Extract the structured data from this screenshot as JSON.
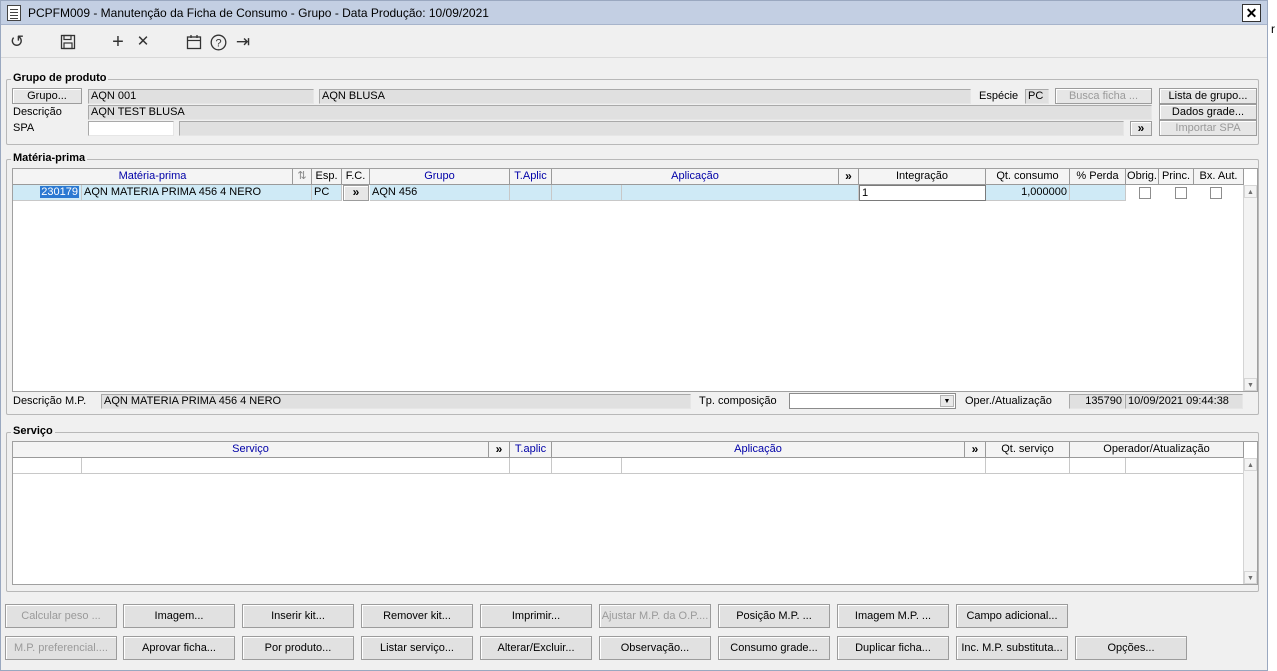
{
  "window": {
    "title": "PCPFM009 - Manutenção da Ficha de Consumo - Grupo - Data Produção: 10/09/2021",
    "close": "✕"
  },
  "toolbar": {
    "refresh": "↺",
    "save": "💾",
    "add": "+",
    "delete": "✕",
    "calendar": "📅",
    "help": "?",
    "exit": "⇥"
  },
  "grupo_produto": {
    "title": "Grupo de produto",
    "grupo_button": "Grupo...",
    "grupo_code": "AQN 001",
    "grupo_name": "AQN BLUSA",
    "especie_label": "Espécie",
    "especie_value": "PC",
    "busca_ficha": "Busca ficha ...",
    "lista_grupo": "Lista de grupo...",
    "descricao_label": "Descrição",
    "descricao_value": "AQN TEST BLUSA",
    "dados_grade": "Dados grade...",
    "spa_label": "SPA",
    "spa_value": "",
    "spa_more": "»",
    "importar_spa": "Importar SPA"
  },
  "materia_prima": {
    "title": "Matéria-prima",
    "headers": {
      "materia": "Matéria-prima",
      "sort": "⇅",
      "esp": "Esp.",
      "fc": "F.C.",
      "grupo": "Grupo",
      "taplic": "T.Aplic",
      "aplicacao": "Aplicação",
      "more": "»",
      "integracao": "Integração",
      "qt_consumo": "Qt. consumo",
      "perda": "% Perda",
      "obrig": "Obrig.",
      "princ": "Princ.",
      "bxaut": "Bx. Aut."
    },
    "row": {
      "code": "230179",
      "name": "AQN MATERIA PRIMA 456 4 NERO",
      "esp": "PC",
      "fc": "»",
      "grupo": "AQN 456",
      "integracao": "1",
      "qt_consumo": "1,000000"
    },
    "descricao_label": "Descrição M.P.",
    "descricao_value": "AQN MATERIA PRIMA 456 4 NERO",
    "tp_composicao_label": "Tp. composição",
    "tp_composicao_value": "",
    "oper_label": "Oper./Atualização",
    "oper_value": "135790",
    "oper_date": "10/09/2021 09:44:38"
  },
  "servico": {
    "title": "Serviço",
    "headers": {
      "servico": "Serviço",
      "more1": "»",
      "taplic": "T.aplic",
      "aplicacao": "Aplicação",
      "more2": "»",
      "qt_servico": "Qt. serviço",
      "operador": "Operador/Atualização"
    }
  },
  "buttons": {
    "row1": [
      "Calcular peso ...",
      "Imagem...",
      "Inserir kit...",
      "Remover kit...",
      "Imprimir...",
      "Ajustar M.P. da O.P....",
      "Posição M.P. ...",
      "Imagem M.P. ...",
      "Campo adicional..."
    ],
    "row2": [
      "M.P. preferencial....",
      "Aprovar ficha...",
      "Por produto...",
      "Listar serviço...",
      "Alterar/Excluir...",
      "Observação...",
      "Consumo grade...",
      "Duplicar ficha...",
      "Inc. M.P. substituta...",
      "Opções..."
    ]
  },
  "scroll": {
    "up": "▲",
    "down": "▼",
    "combo": "▼"
  },
  "side_char": "r"
}
